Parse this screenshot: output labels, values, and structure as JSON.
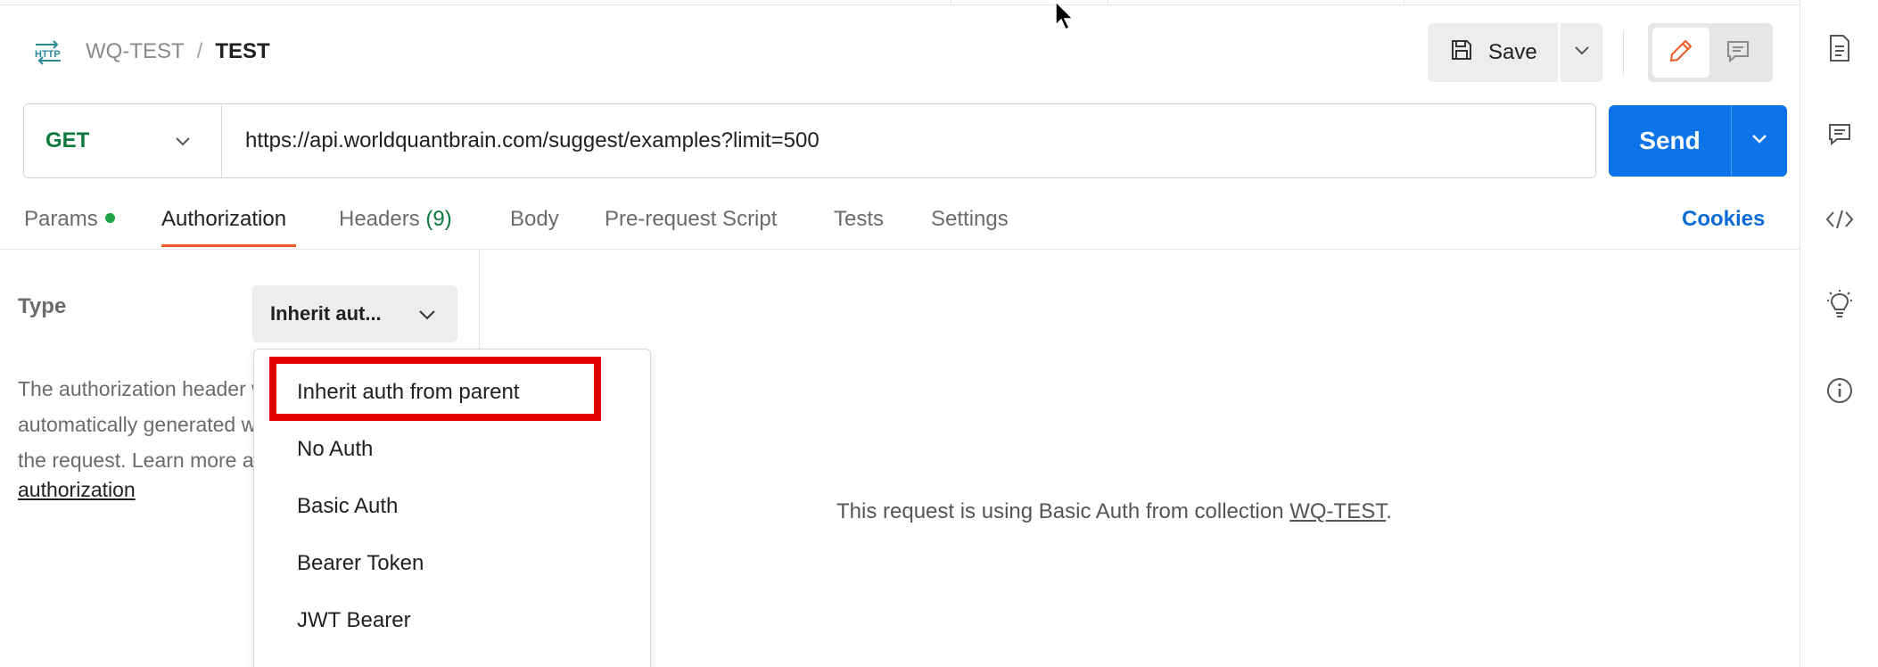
{
  "breadcrumb": {
    "protocol_icon": "http-icon",
    "parent": "WQ-TEST",
    "separator": "/",
    "current": "TEST"
  },
  "toolbar": {
    "save_label": "Save",
    "save_icon": "floppy-disk-icon",
    "edit_mode_icon": "pencil-icon",
    "comment_mode_icon": "comment-icon"
  },
  "request": {
    "method": "GET",
    "url": "https://api.worldquantbrain.com/suggest/examples?limit=500",
    "send_label": "Send"
  },
  "tabs": [
    {
      "label": "Params",
      "has_dot": true
    },
    {
      "label": "Authorization",
      "active": true
    },
    {
      "label": "Headers",
      "count": "(9)"
    },
    {
      "label": "Body"
    },
    {
      "label": "Pre-request Script"
    },
    {
      "label": "Tests"
    },
    {
      "label": "Settings"
    }
  ],
  "cookies_label": "Cookies",
  "auth": {
    "type_label": "Type",
    "type_value": "Inherit aut...",
    "description_lines": [
      "The authorization header will be",
      "automatically generated when you send",
      "the request. Learn more about"
    ],
    "learn_link": "authorization",
    "dropdown_options": [
      "Inherit auth from parent",
      "No Auth",
      "Basic Auth",
      "Bearer Token",
      "JWT Bearer"
    ],
    "highlighted_option": "Inherit auth from parent"
  },
  "main_message": {
    "prefix": "This request is using Basic Auth from collection ",
    "link": "WQ-TEST",
    "suffix": "."
  },
  "right_sidebar": [
    "document-icon",
    "comment-icon",
    "code-icon",
    "lightbulb-icon",
    "info-icon"
  ],
  "colors": {
    "accent_orange": "#ef5b25",
    "send_blue": "#0c74e8",
    "method_green": "#0b7a3e",
    "highlight_red": "#e00000"
  }
}
